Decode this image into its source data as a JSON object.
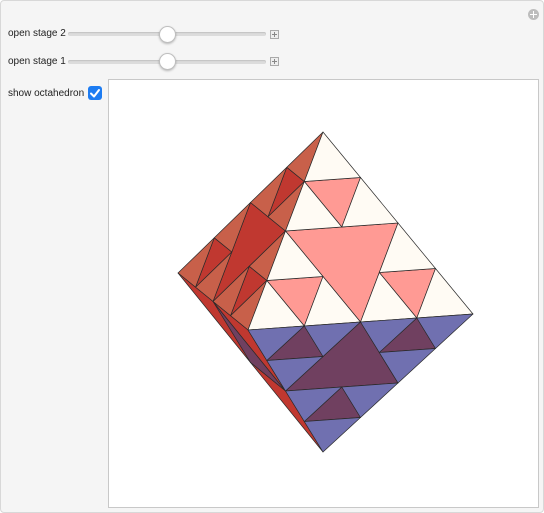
{
  "controls": {
    "stage2": {
      "label": "open stage 2",
      "value": 0.5
    },
    "stage1": {
      "label": "open stage 1",
      "value": 0.5
    },
    "octahedron": {
      "label": "show octahedron",
      "checked": true
    }
  },
  "colors": {
    "top_light": "#fffbf4",
    "top_pink": "#ff9a94",
    "left_outer": "#c8604a",
    "left_inner": "#c03830",
    "bottom_blue": "#7070b0",
    "bottom_dark": "#704060",
    "checkbox": "#1d7cf2"
  }
}
